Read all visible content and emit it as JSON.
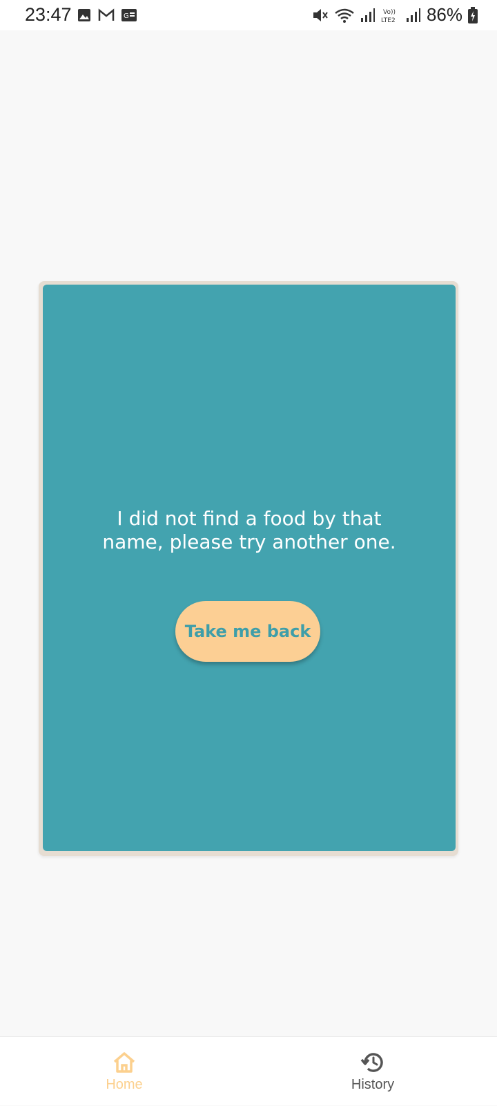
{
  "status_bar": {
    "time": "23:47",
    "battery": "86%",
    "left_icons": [
      "gallery-icon",
      "gmail-icon",
      "news-icon"
    ],
    "right_icons": [
      "mute-icon",
      "wifi-icon",
      "signal-icon",
      "volte-lte2-icon",
      "signal2-icon",
      "battery-charging-icon"
    ]
  },
  "main": {
    "message": "I did not find a food by that name, please try another one.",
    "button_label": "Take me back"
  },
  "bottom_nav": {
    "items": [
      {
        "label": "Home",
        "icon": "home-icon",
        "active": true
      },
      {
        "label": "History",
        "icon": "history-icon",
        "active": false
      }
    ]
  },
  "colors": {
    "background": "#f8f8f8",
    "card_border": "#e6ddd2",
    "card": "#43a3af",
    "button": "#fccf94",
    "button_text": "#3e9ea9",
    "active_nav": "#fcd08e"
  }
}
